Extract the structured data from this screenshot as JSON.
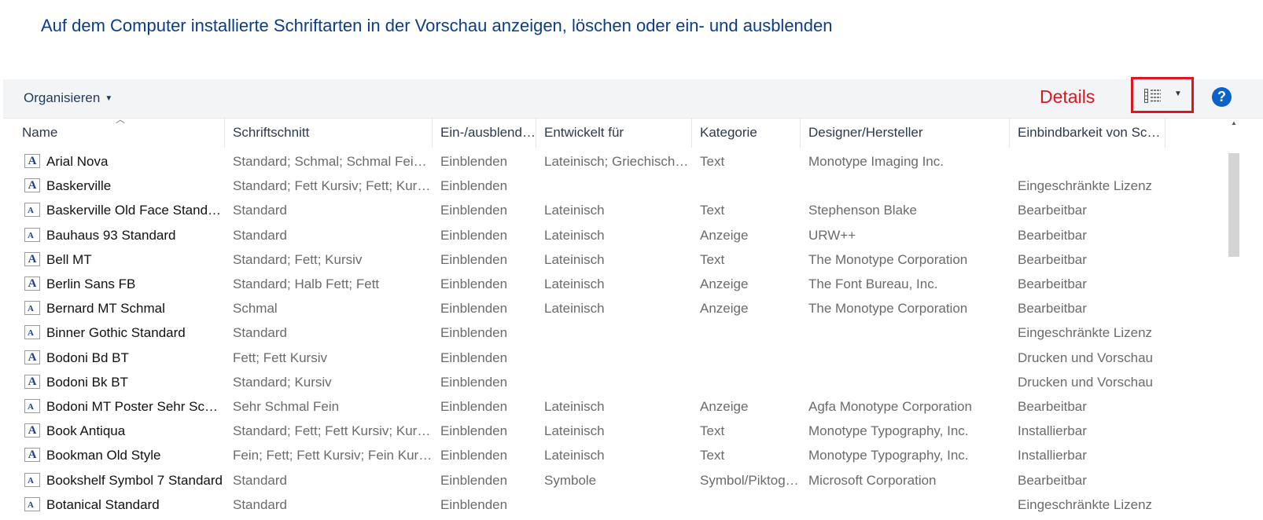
{
  "title": "Auf dem Computer installierte Schriftarten in der Vorschau anzeigen, löschen oder ein- und ausblenden",
  "toolbar": {
    "organize_label": "Organisieren",
    "annotation_label": "Details",
    "help_label": "?"
  },
  "columns": [
    "Name",
    "Schriftschnitt",
    "Ein-/ausblenden",
    "Entwickelt für",
    "Kategorie",
    "Designer/Hersteller",
    "Einbindbarkeit von Schriftarten"
  ],
  "fonts": [
    {
      "name": "Arial Nova",
      "style": "Standard; Schmal; Schmal Fein; Fett",
      "visibility": "Einblenden",
      "designed_for": "Lateinisch; Griechisch; Kyrillisch",
      "category": "Text",
      "designer": "Monotype Imaging Inc.",
      "embeddability": "",
      "icon": "truetype-icon"
    },
    {
      "name": "Baskerville",
      "style": "Standard; Fett Kursiv; Fett; Kursiv",
      "visibility": "Einblenden",
      "designed_for": "",
      "category": "",
      "designer": "",
      "embeddability": "Eingeschränkte Lizenz",
      "icon": "truetype-icon"
    },
    {
      "name": "Baskerville Old Face Standard",
      "style": "Standard",
      "visibility": "Einblenden",
      "designed_for": "Lateinisch",
      "category": "Text",
      "designer": "Stephenson Blake",
      "embeddability": "Bearbeitbar",
      "icon": "font-file-icon"
    },
    {
      "name": "Bauhaus 93 Standard",
      "style": "Standard",
      "visibility": "Einblenden",
      "designed_for": "Lateinisch",
      "category": "Anzeige",
      "designer": "URW++",
      "embeddability": "Bearbeitbar",
      "icon": "font-file-icon"
    },
    {
      "name": "Bell MT",
      "style": "Standard; Fett; Kursiv",
      "visibility": "Einblenden",
      "designed_for": "Lateinisch",
      "category": "Text",
      "designer": "The Monotype Corporation",
      "embeddability": "Bearbeitbar",
      "icon": "truetype-icon"
    },
    {
      "name": "Berlin Sans FB",
      "style": "Standard; Halb Fett; Fett",
      "visibility": "Einblenden",
      "designed_for": "Lateinisch",
      "category": "Anzeige",
      "designer": "The Font Bureau, Inc.",
      "embeddability": "Bearbeitbar",
      "icon": "truetype-icon"
    },
    {
      "name": "Bernard MT Schmal",
      "style": "Schmal",
      "visibility": "Einblenden",
      "designed_for": "Lateinisch",
      "category": "Anzeige",
      "designer": "The Monotype Corporation",
      "embeddability": "Bearbeitbar",
      "icon": "font-file-icon"
    },
    {
      "name": "Binner Gothic Standard",
      "style": "Standard",
      "visibility": "Einblenden",
      "designed_for": "",
      "category": "",
      "designer": "",
      "embeddability": "Eingeschränkte Lizenz",
      "icon": "font-file-icon"
    },
    {
      "name": "Bodoni Bd BT",
      "style": "Fett; Fett Kursiv",
      "visibility": "Einblenden",
      "designed_for": "",
      "category": "",
      "designer": "",
      "embeddability": "Drucken und Vorschau",
      "icon": "truetype-icon"
    },
    {
      "name": "Bodoni Bk BT",
      "style": "Standard; Kursiv",
      "visibility": "Einblenden",
      "designed_for": "",
      "category": "",
      "designer": "",
      "embeddability": "Drucken und Vorschau",
      "icon": "truetype-icon"
    },
    {
      "name": "Bodoni MT Poster Sehr Schmal Fein",
      "style": "Sehr Schmal Fein",
      "visibility": "Einblenden",
      "designed_for": "Lateinisch",
      "category": "Anzeige",
      "designer": "Agfa Monotype Corporation",
      "embeddability": "Bearbeitbar",
      "icon": "font-file-icon"
    },
    {
      "name": "Book Antiqua",
      "style": "Standard; Fett; Fett Kursiv; Kursiv",
      "visibility": "Einblenden",
      "designed_for": "Lateinisch",
      "category": "Text",
      "designer": "Monotype Typography, Inc.",
      "embeddability": "Installierbar",
      "icon": "truetype-icon"
    },
    {
      "name": "Bookman Old Style",
      "style": "Fein; Fett; Fett Kursiv; Fein Kursiv",
      "visibility": "Einblenden",
      "designed_for": "Lateinisch",
      "category": "Text",
      "designer": "Monotype Typography, Inc.",
      "embeddability": "Installierbar",
      "icon": "truetype-icon"
    },
    {
      "name": "Bookshelf Symbol 7 Standard",
      "style": "Standard",
      "visibility": "Einblenden",
      "designed_for": "Symbole",
      "category": "Symbol/Piktogramm",
      "designer": "Microsoft Corporation",
      "embeddability": "Bearbeitbar",
      "icon": "font-file-icon"
    },
    {
      "name": "Botanical Standard",
      "style": "Standard",
      "visibility": "Einblenden",
      "designed_for": "",
      "category": "",
      "designer": "",
      "embeddability": "Eingeschränkte Lizenz",
      "icon": "font-file-icon"
    }
  ]
}
